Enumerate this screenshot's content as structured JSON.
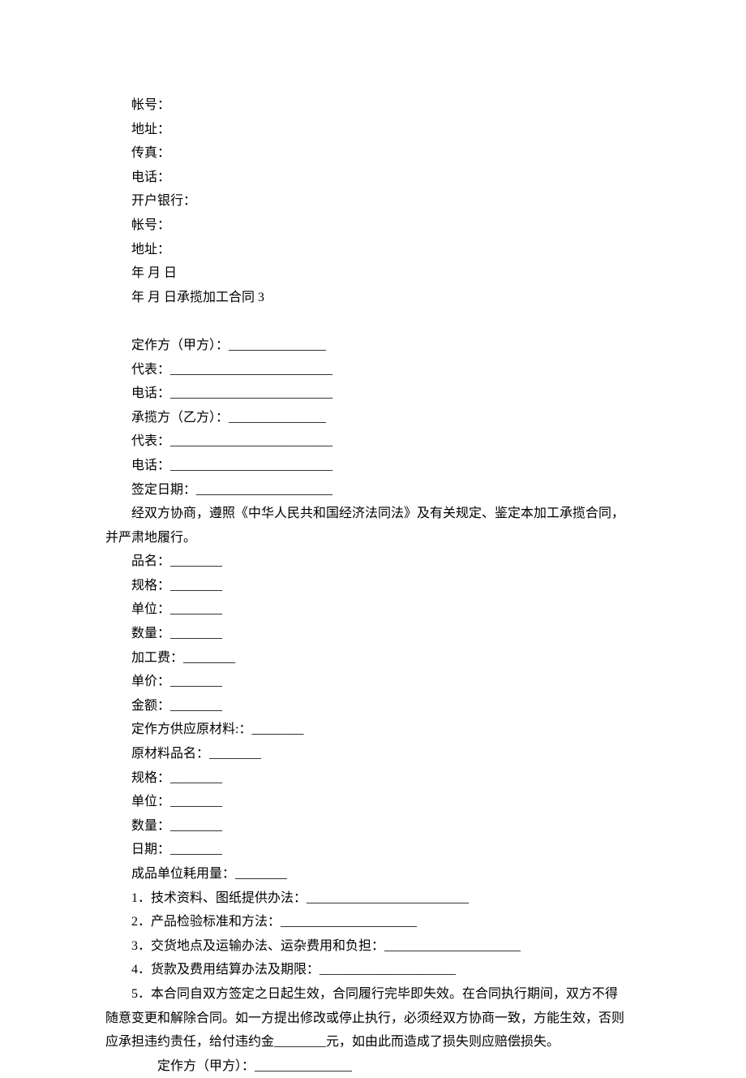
{
  "lines": [
    {
      "text": "帐号：",
      "indent": true
    },
    {
      "text": "地址：",
      "indent": true
    },
    {
      "text": "传真：",
      "indent": true
    },
    {
      "text": "电话：",
      "indent": true
    },
    {
      "text": "开户银行：",
      "indent": true
    },
    {
      "text": "帐号：",
      "indent": true
    },
    {
      "text": "地址：",
      "indent": true
    },
    {
      "text": "年  月  日",
      "indent": true
    },
    {
      "text": "年  月  日承揽加工合同 3",
      "indent": true
    },
    {
      "text": " ",
      "indent": true
    },
    {
      "text": "定作方（甲方）：_______________",
      "indent": true
    },
    {
      "text": "代表：_________________________",
      "indent": true
    },
    {
      "text": "电话：_________________________",
      "indent": true
    },
    {
      "text": "承揽方（乙方）：_______________",
      "indent": true
    },
    {
      "text": "代表：_________________________",
      "indent": true
    },
    {
      "text": "电话：_________________________",
      "indent": true
    },
    {
      "text": "签定日期：_____________________",
      "indent": true
    },
    {
      "text": "经双方协商，遵照《中华人民共和国经济法同法》及有关规定、鉴定本加工承揽合同，",
      "indent": true
    },
    {
      "text": "并严肃地履行。",
      "indent": false
    },
    {
      "text": "品名：________",
      "indent": true
    },
    {
      "text": "规格：________",
      "indent": true
    },
    {
      "text": "单位：________",
      "indent": true
    },
    {
      "text": "数量：________",
      "indent": true
    },
    {
      "text": "加工费：________",
      "indent": true
    },
    {
      "text": "单价：________",
      "indent": true
    },
    {
      "text": "金额：________",
      "indent": true
    },
    {
      "text": "定作方供应原材料:：________",
      "indent": true
    },
    {
      "text": "原材料品名：________",
      "indent": true
    },
    {
      "text": "规格：________",
      "indent": true
    },
    {
      "text": "单位：________",
      "indent": true
    },
    {
      "text": "数量：________",
      "indent": true
    },
    {
      "text": "日期：________",
      "indent": true
    },
    {
      "text": "成品单位耗用量：________",
      "indent": true
    },
    {
      "text": "1．技术资料、图纸提供办法：_________________________",
      "indent": true
    },
    {
      "text": "2．产品检验标准和方法：_____________________",
      "indent": true
    },
    {
      "text": "3．交货地点及运输办法、运杂费用和负担：_____________________",
      "indent": true
    },
    {
      "text": "4．货款及费用结算办法及期限：_____________________",
      "indent": true
    },
    {
      "text": "5．本合同自双方签定之日起生效，合同履行完毕即失效。在合同执行期间，双方不得",
      "indent": true
    },
    {
      "text": "随意变更和解除合同。如一方提出修改或停止执行，必须经双方协商一致，方能生效，否则",
      "indent": false
    },
    {
      "text": "应承担违约责任，给付违约金________元，如由此而造成了损失则应赔偿损失。",
      "indent": false
    },
    {
      "text": "　　定作方（甲方）：_______________",
      "indent": true
    }
  ]
}
